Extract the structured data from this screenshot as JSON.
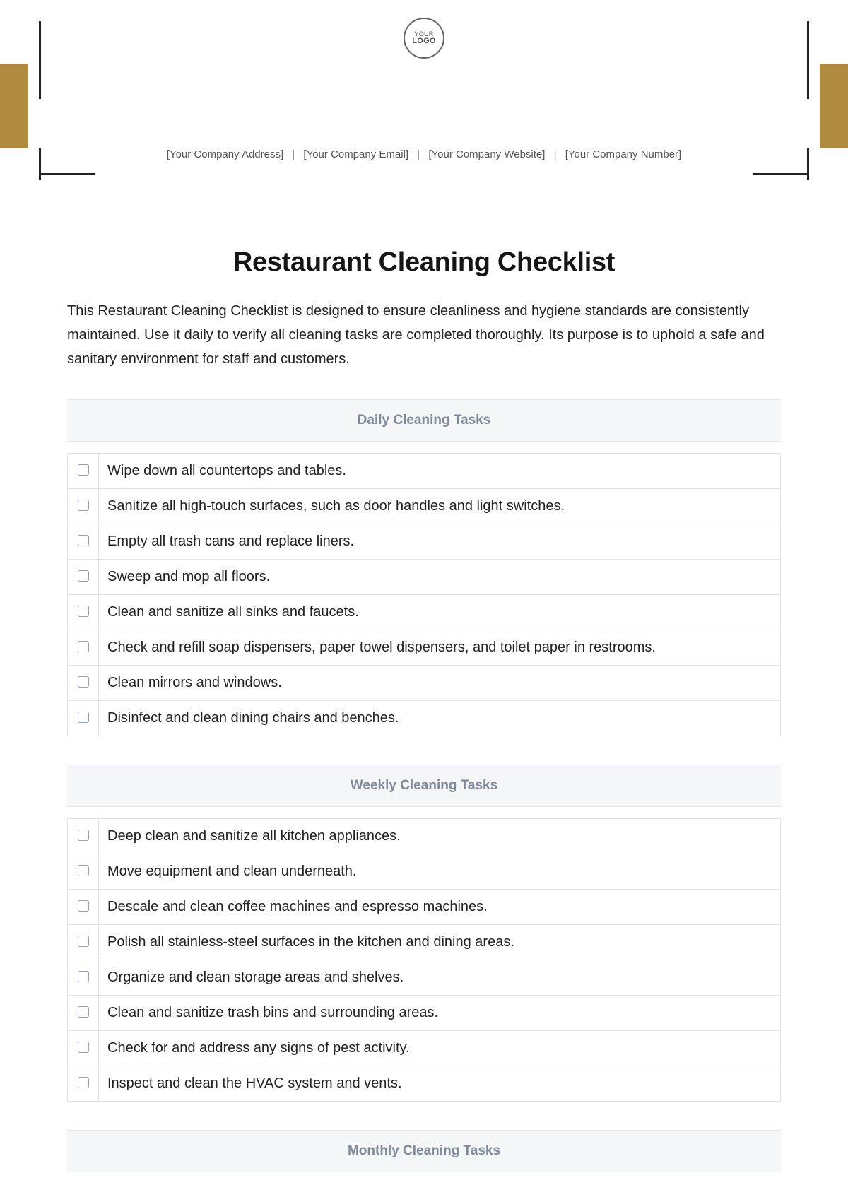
{
  "logo": {
    "line1": "YOUR",
    "line2": "LOGO"
  },
  "company": {
    "address": "[Your Company Address]",
    "email": "[Your Company Email]",
    "website": "[Your Company Website]",
    "number": "[Your Company Number]"
  },
  "title": "Restaurant Cleaning Checklist",
  "intro": "This Restaurant Cleaning Checklist is designed to ensure cleanliness and hygiene standards are consistently maintained. Use it daily to verify all cleaning tasks are completed thoroughly. Its purpose is to uphold a safe and sanitary environment for staff and customers.",
  "sections": [
    {
      "heading": "Daily Cleaning Tasks",
      "items": [
        "Wipe down all countertops and tables.",
        "Sanitize all high-touch surfaces, such as door handles and light switches.",
        "Empty all trash cans and replace liners.",
        "Sweep and mop all floors.",
        "Clean and sanitize all sinks and faucets.",
        "Check and refill soap dispensers, paper towel dispensers, and toilet paper in restrooms.",
        "Clean mirrors and windows.",
        "Disinfect and clean dining chairs and benches."
      ]
    },
    {
      "heading": "Weekly Cleaning Tasks",
      "items": [
        "Deep clean and sanitize all kitchen appliances.",
        "Move equipment and clean underneath.",
        "Descale and clean coffee machines and espresso machines.",
        "Polish all stainless-steel surfaces in the kitchen and dining areas.",
        "Organize and clean storage areas and shelves.",
        "Clean and sanitize trash bins and surrounding areas.",
        "Check for and address any signs of pest activity.",
        "Inspect and clean the HVAC system and vents."
      ]
    },
    {
      "heading": "Monthly Cleaning Tasks",
      "items": []
    }
  ]
}
